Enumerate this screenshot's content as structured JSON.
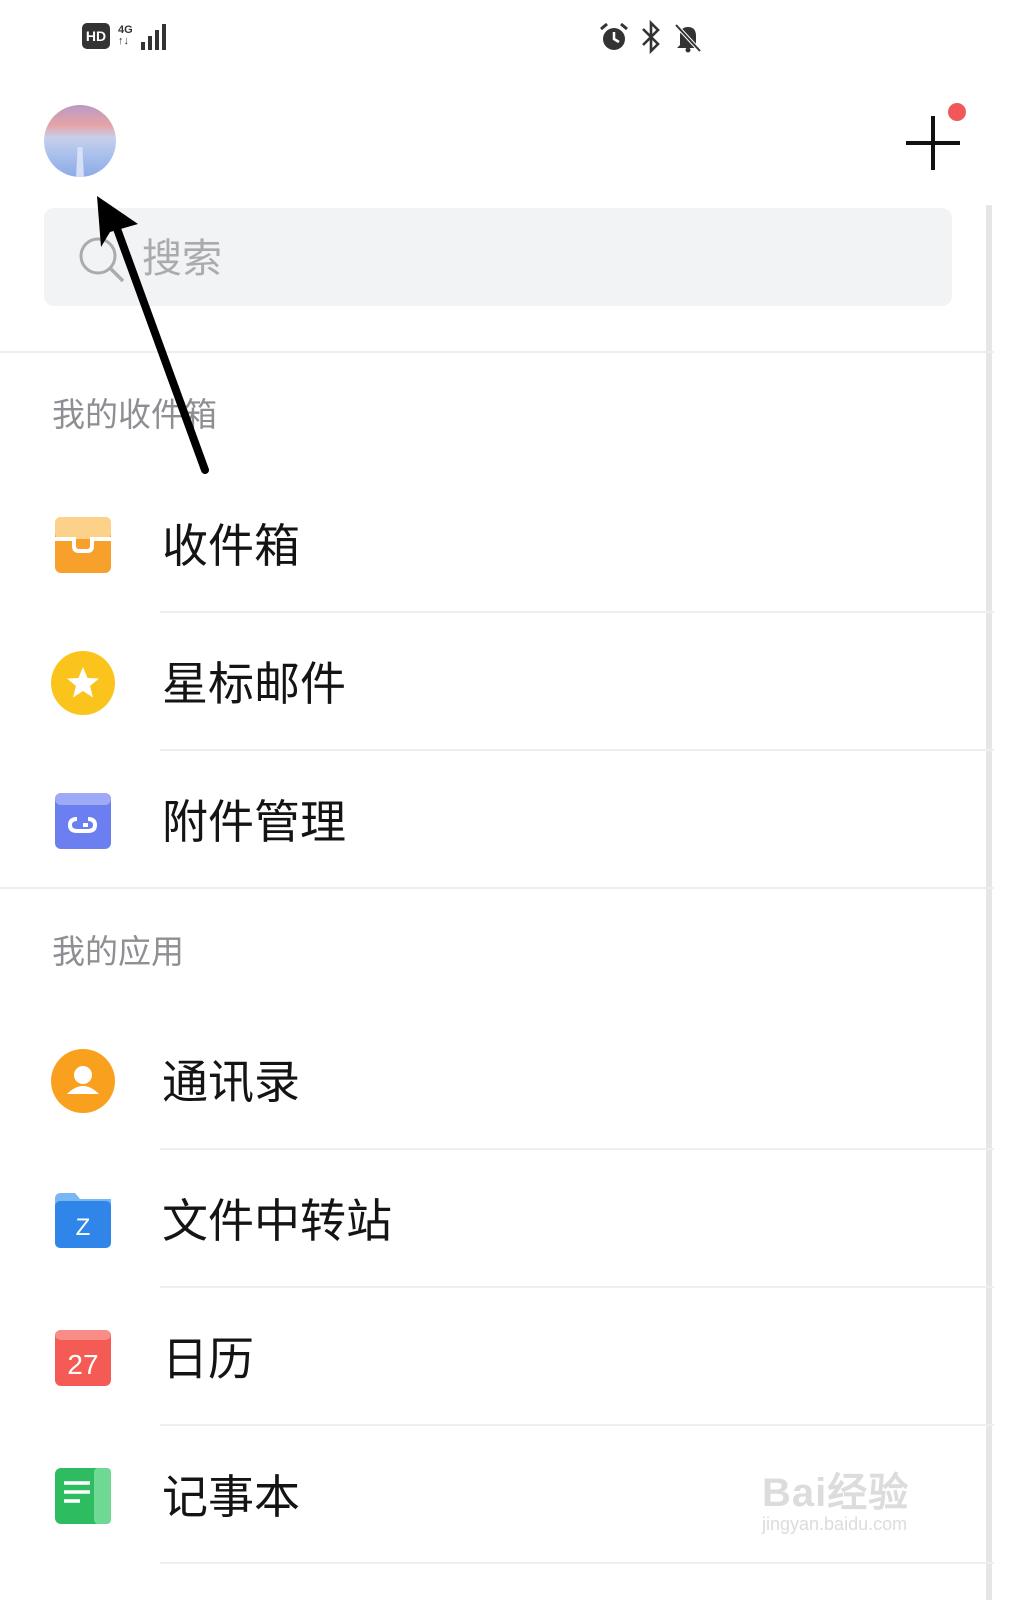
{
  "status_bar": {
    "hd": "HD",
    "network": "4G",
    "icons_left": [
      "hd-icon",
      "signal-icon"
    ],
    "icons_right": [
      "alarm-icon",
      "bluetooth-icon",
      "bell-off-icon"
    ]
  },
  "header": {
    "avatar": "avatar",
    "add_icon": "plus-icon",
    "notification_dot_color": "#f1585b"
  },
  "search": {
    "placeholder": "搜索",
    "icon": "search-icon"
  },
  "sections": {
    "inbox_title": "我的收件箱",
    "apps_title": "我的应用"
  },
  "inbox_items": [
    {
      "label": "收件箱",
      "icon": "inbox-icon",
      "color": "#f7a12c"
    },
    {
      "label": "星标邮件",
      "icon": "star-icon",
      "color": "#fbc41c"
    },
    {
      "label": "附件管理",
      "icon": "attachment-icon",
      "color": "#6c7ff0"
    }
  ],
  "app_items": [
    {
      "label": "通讯录",
      "icon": "contacts-icon",
      "color": "#f9a11e"
    },
    {
      "label": "文件中转站",
      "icon": "folder-icon",
      "color": "#2f86e8",
      "badge": "Z"
    },
    {
      "label": "日历",
      "icon": "calendar-icon",
      "color": "#f45b55",
      "badge": "27"
    },
    {
      "label": "记事本",
      "icon": "notepad-icon",
      "color": "#2dbd60"
    }
  ],
  "watermark": {
    "main": "Bai经验",
    "sub": "jingyan.baidu.com"
  }
}
